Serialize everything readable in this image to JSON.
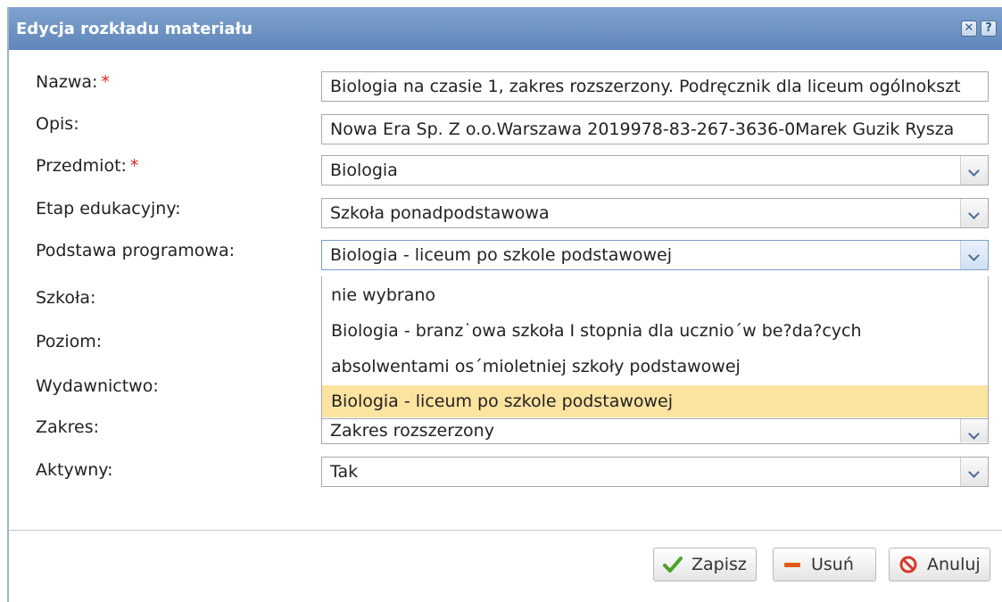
{
  "dialog": {
    "title": "Edycja rozkładu materiału",
    "close_label": "✕",
    "help_label": "?"
  },
  "form": {
    "nazwa": {
      "label": "Nazwa:",
      "required": "*",
      "value": "Biologia na czasie 1, zakres rozszerzony. Podręcznik dla liceum ogólnokszt"
    },
    "opis": {
      "label": "Opis:",
      "value": "Nowa Era Sp. Z o.o.Warszawa 2019978-83-267-3636-0Marek Guzik Rysza"
    },
    "przedmiot": {
      "label": "Przedmiot:",
      "required": "*",
      "value": "Biologia"
    },
    "etap": {
      "label": "Etap edukacyjny:",
      "value": "Szkoła ponadpodstawowa"
    },
    "podstawa": {
      "label": "Podstawa programowa:",
      "value": "Biologia - liceum po szkole podstawowej"
    },
    "szkola": {
      "label": "Szkoła:"
    },
    "poziom": {
      "label": "Poziom:"
    },
    "wydawnictwo": {
      "label": "Wydawnictwo:"
    },
    "zakres": {
      "label": "Zakres:",
      "value": "Zakres rozszerzony"
    },
    "aktywny": {
      "label": "Aktywny:",
      "value": "Tak"
    }
  },
  "dropdown": {
    "options": [
      "nie wybrano",
      "Biologia - branz˙owa szkoła I stopnia dla ucznio´w be?da?cych",
      "absolwentami os´mioletniej szkoły podstawowej",
      "Biologia - liceum po szkole podstawowej"
    ],
    "selected_index": 3
  },
  "buttons": {
    "save": "Zapisz",
    "delete": "Usuń",
    "cancel": "Anuluj"
  },
  "colors": {
    "titlebar": "#6f95c5",
    "selected_option": "#fbe3a0",
    "required": "#dd2222"
  }
}
